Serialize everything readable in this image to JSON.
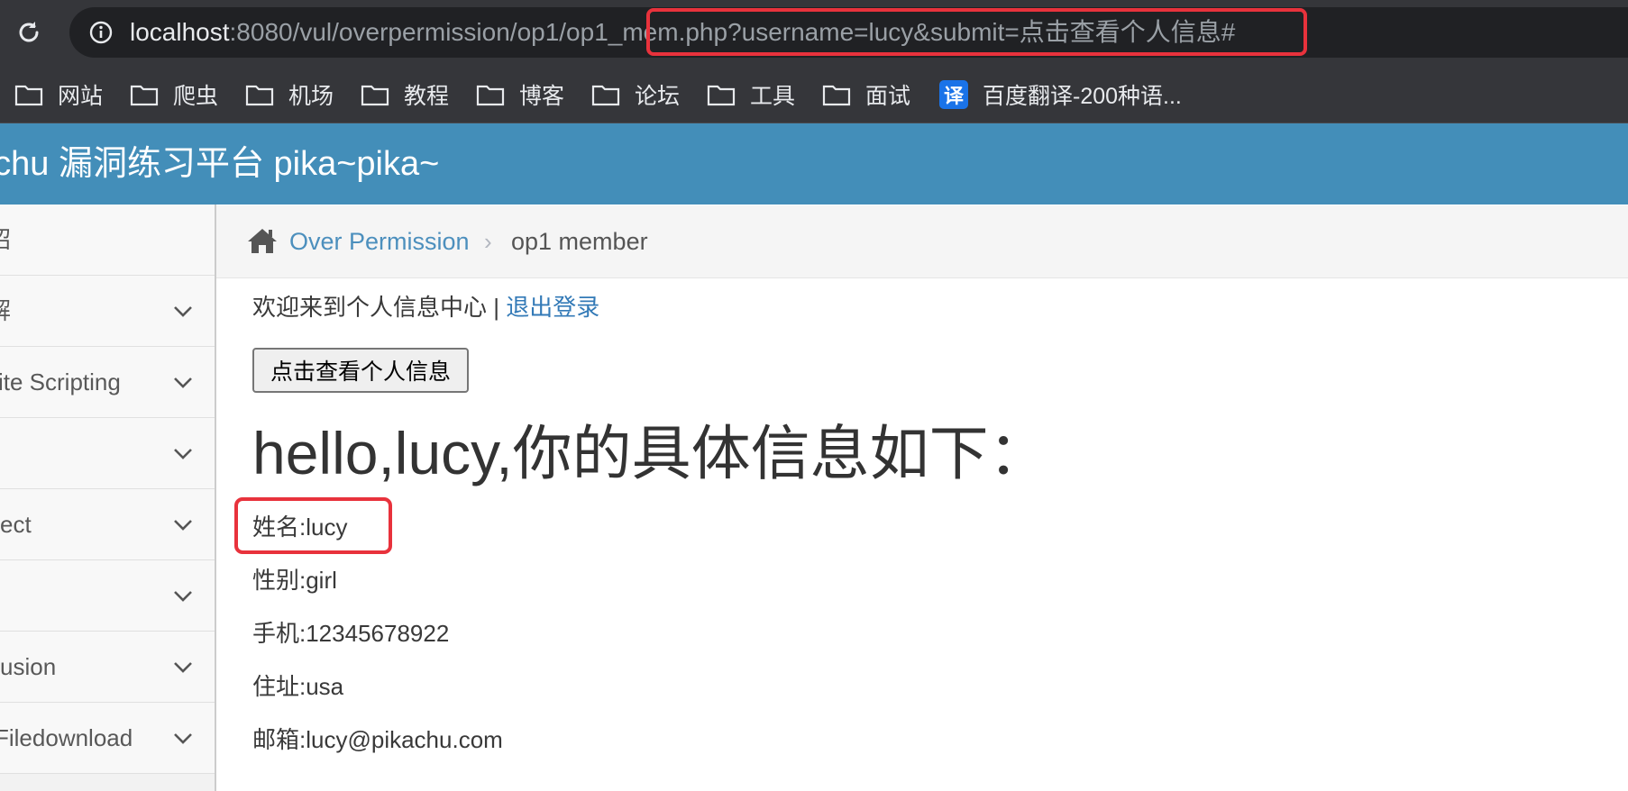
{
  "browser": {
    "url_host": "localhost",
    "url_rest": ":8080/vul/overpermission/op1/op1_mem.php?username=lucy&submit=点击查看个人信息#",
    "bookmarks": [
      {
        "label": "网站",
        "icon": "folder-icon"
      },
      {
        "label": "爬虫",
        "icon": "folder-icon"
      },
      {
        "label": "机场",
        "icon": "folder-icon"
      },
      {
        "label": "教程",
        "icon": "folder-icon"
      },
      {
        "label": "博客",
        "icon": "folder-icon"
      },
      {
        "label": "论坛",
        "icon": "folder-icon"
      },
      {
        "label": "工具",
        "icon": "folder-icon"
      },
      {
        "label": "面试",
        "icon": "folder-icon"
      },
      {
        "label": "百度翻译-200种语...",
        "icon": "translate-icon",
        "icon_text": "译"
      }
    ]
  },
  "header": {
    "title": "kachu 漏洞练习平台 pika~pika~"
  },
  "sidebar": {
    "items": [
      {
        "label": "绍"
      },
      {
        "label": "解"
      },
      {
        "label": "ite Scripting"
      },
      {
        "label": ""
      },
      {
        "label": "ect"
      },
      {
        "label": ""
      },
      {
        "label": "usion"
      },
      {
        "label": " Filedownload"
      }
    ]
  },
  "breadcrumb": {
    "link": "Over Permission",
    "separator": "›",
    "current": "op1 member"
  },
  "main": {
    "welcome_text": "欢迎来到个人信息中心 | ",
    "logout_link": "退出登录",
    "view_button": "点击查看个人信息",
    "greeting": "hello,lucy,你的具体信息如下：",
    "info": [
      "姓名:lucy",
      "性别:girl",
      "手机:12345678922",
      "住址:usa",
      "邮箱:lucy@pikachu.com"
    ]
  },
  "colors": {
    "browser_chrome": "#35363a",
    "omnibox": "#202124",
    "header": "#438eb9",
    "highlight": "#e8323c",
    "link": "#4c8fbd"
  }
}
